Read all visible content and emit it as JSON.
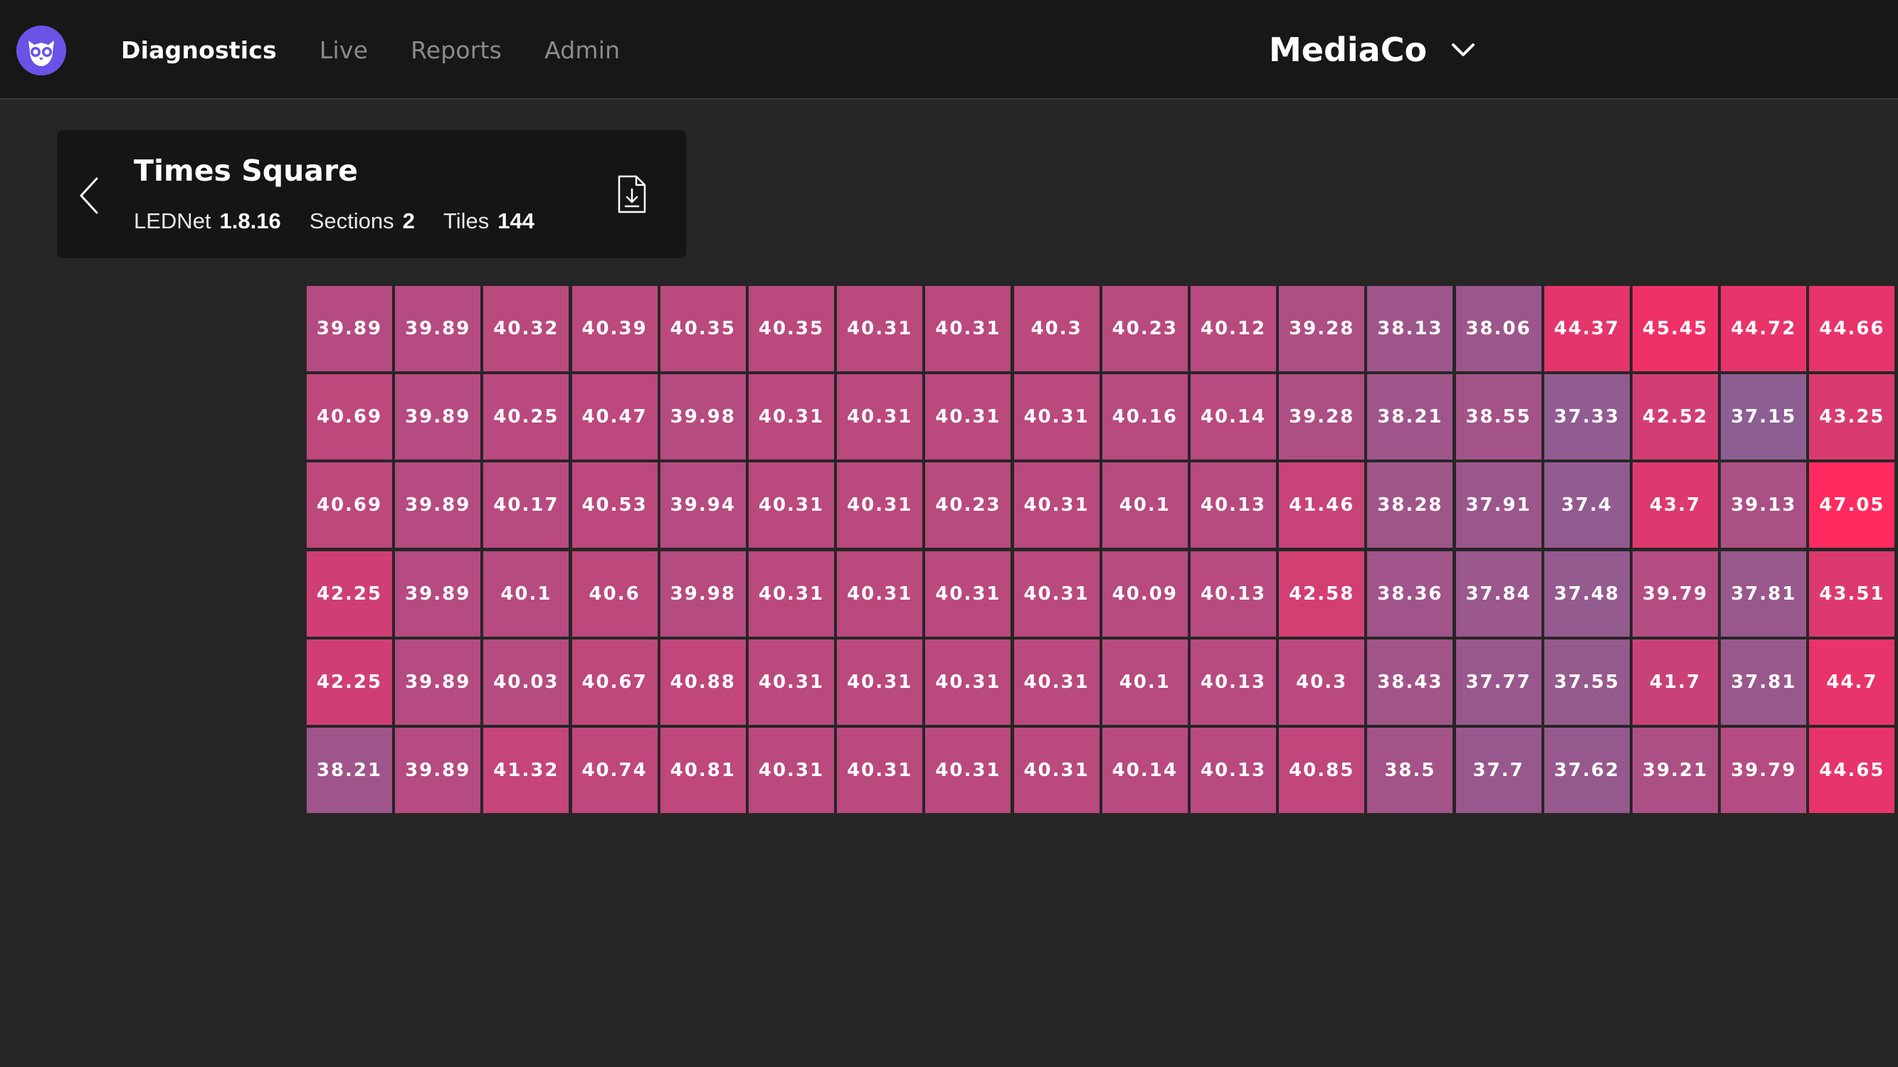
{
  "nav": {
    "items": [
      {
        "key": "diagnostics",
        "label": "Diagnostics",
        "active": true
      },
      {
        "key": "live",
        "label": "Live",
        "active": false
      },
      {
        "key": "reports",
        "label": "Reports",
        "active": false
      },
      {
        "key": "admin",
        "label": "Admin",
        "active": false
      }
    ]
  },
  "org": {
    "name": "MediaCo",
    "icon": "chevron-down-icon"
  },
  "site": {
    "title": "Times Square",
    "lednet_label": "LEDNet",
    "lednet_version": "1.8.16",
    "sections_label": "Sections",
    "sections_value": "2",
    "tiles_label": "Tiles",
    "tiles_value": "144",
    "back_icon": "chevron-left-icon",
    "download_icon": "download-file-icon"
  },
  "colors": {
    "accent_logo": "#6b52e6",
    "heat_low": "#8c5e92",
    "heat_high": "#fe2a60"
  },
  "heatmap": {
    "columns": 18,
    "rows": [
      [
        "39.89",
        "39.89",
        "40.32",
        "40.39",
        "40.35",
        "40.35",
        "40.31",
        "40.31",
        "40.3",
        "40.23",
        "40.12",
        "39.28",
        "38.13",
        "38.06",
        "44.37",
        "45.45",
        "44.72",
        "44.66"
      ],
      [
        "40.69",
        "39.89",
        "40.25",
        "40.47",
        "39.98",
        "40.31",
        "40.31",
        "40.31",
        "40.31",
        "40.16",
        "40.14",
        "39.28",
        "38.21",
        "38.55",
        "37.33",
        "42.52",
        "37.15",
        "43.25"
      ],
      [
        "40.69",
        "39.89",
        "40.17",
        "40.53",
        "39.94",
        "40.31",
        "40.31",
        "40.23",
        "40.31",
        "40.1",
        "40.13",
        "41.46",
        "38.28",
        "37.91",
        "37.4",
        "43.7",
        "39.13",
        "47.05"
      ],
      [
        "42.25",
        "39.89",
        "40.1",
        "40.6",
        "39.98",
        "40.31",
        "40.31",
        "40.31",
        "40.31",
        "40.09",
        "40.13",
        "42.58",
        "38.36",
        "37.84",
        "37.48",
        "39.79",
        "37.81",
        "43.51"
      ],
      [
        "42.25",
        "39.89",
        "40.03",
        "40.67",
        "40.88",
        "40.31",
        "40.31",
        "40.31",
        "40.31",
        "40.1",
        "40.13",
        "40.3",
        "38.43",
        "37.77",
        "37.55",
        "41.7",
        "37.81",
        "44.7"
      ],
      [
        "38.21",
        "39.89",
        "41.32",
        "40.74",
        "40.81",
        "40.31",
        "40.31",
        "40.31",
        "40.31",
        "40.14",
        "40.13",
        "40.85",
        "38.5",
        "37.7",
        "37.62",
        "39.21",
        "39.79",
        "44.65"
      ]
    ]
  }
}
